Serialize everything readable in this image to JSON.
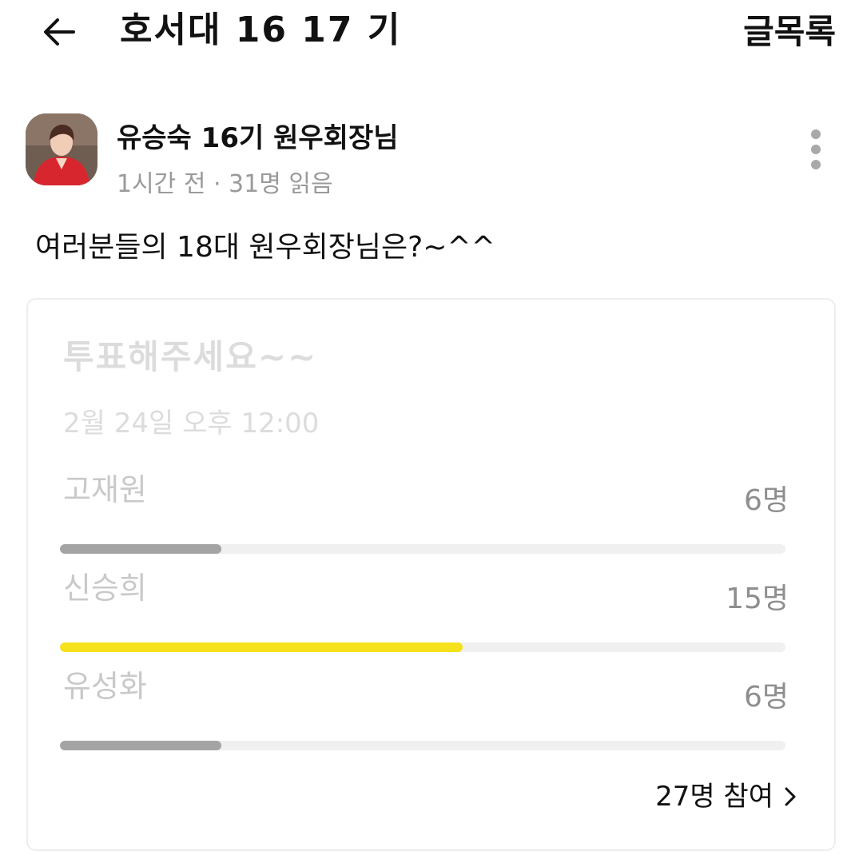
{
  "header": {
    "title": "호서대 16 17 기",
    "right_link": "글목록"
  },
  "post": {
    "author": "유승숙 16기 원우회장님",
    "meta": "1시간 전 · 31명 읽음",
    "text": "여러분들의 18대 원우회장님은?~^^"
  },
  "poll": {
    "title": "투표해주세요~~",
    "date": "2월 24일 오후 12:00",
    "options": [
      {
        "name": "고재원",
        "count_label": "6명",
        "votes": 6,
        "color": "#a4a4a4"
      },
      {
        "name": "신승희",
        "count_label": "15명",
        "votes": 15,
        "color": "#f5e21c"
      },
      {
        "name": "유성화",
        "count_label": "6명",
        "votes": 6,
        "color": "#a4a4a4"
      }
    ],
    "total_votes": 27,
    "participants_label": "27명 참여"
  },
  "icons": {
    "back": "back-arrow-icon",
    "more": "more-vertical-icon",
    "chevron": "chevron-right-icon"
  }
}
